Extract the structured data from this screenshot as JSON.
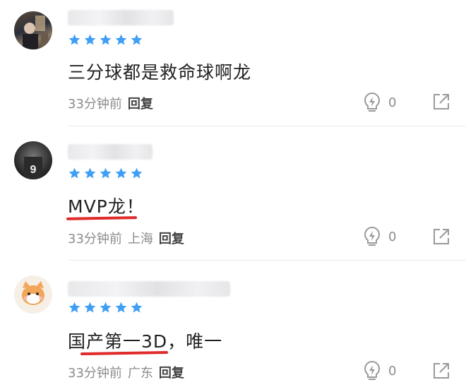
{
  "comments": [
    {
      "rating": 5,
      "text": "三分球都是救命球啊龙",
      "time": "33分钟前",
      "location": "",
      "reply_label": "回复",
      "likes": "0"
    },
    {
      "rating": 5,
      "text": "MVP龙！",
      "time": "33分钟前",
      "location": "上海",
      "reply_label": "回复",
      "likes": "0"
    },
    {
      "rating": 5,
      "text": "国产第一3D，唯一",
      "time": "33分钟前",
      "location": "广东",
      "reply_label": "回复",
      "likes": "0"
    }
  ],
  "avatar_jersey_number": "9",
  "colors": {
    "star": "#3f9ef6",
    "underline": "#e02b2b",
    "meta": "#8c8c8c",
    "text": "#222222"
  },
  "icons": {
    "like": "lightbulb-like-icon",
    "share": "share-icon"
  }
}
